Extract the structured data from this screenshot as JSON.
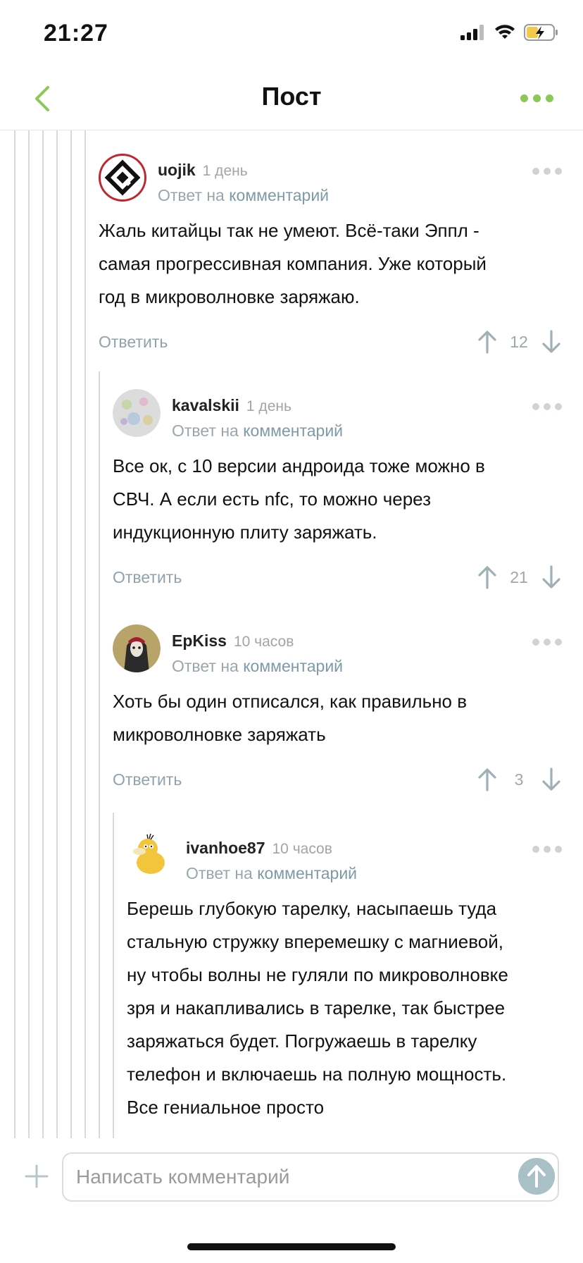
{
  "status": {
    "time": "21:27"
  },
  "nav": {
    "title": "Пост"
  },
  "colors": {
    "accent": "#8ac858",
    "link": "#7d9aa8",
    "muted": "#9aa6ab"
  },
  "comments": [
    {
      "author": "uojik",
      "time": "1 день",
      "reply_prefix": "Ответ на",
      "reply_link": "комментарий",
      "text_lines": [
        "Жаль китайцы так не умеют. Всё-таки Эппл -",
        "самая прогрессивная компания. Уже который",
        "год в микроволновке заряжаю."
      ],
      "reply_label": "Ответить",
      "votes": "12",
      "avatar_icon": "g-logo-avatar"
    },
    {
      "author": "kavalskii",
      "time": "1 день",
      "reply_prefix": "Ответ на",
      "reply_link": "комментарий",
      "text_lines": [
        "Все ок, с 10 версии андроида тоже можно в",
        "СВЧ. А если есть nfc, то можно через",
        "индукционную плиту заряжать."
      ],
      "reply_label": "Ответить",
      "votes": "21",
      "avatar_icon": "photo-avatar"
    },
    {
      "author": "EpKiss",
      "time": "10 часов",
      "reply_prefix": "Ответ на",
      "reply_link": "комментарий",
      "text_lines": [
        "Хоть бы один отписался,  как правильно в",
        "микроволновке заряжать"
      ],
      "reply_label": "Ответить",
      "votes": "3",
      "avatar_icon": "hooded-figure-avatar"
    },
    {
      "author": "ivanhoe87",
      "time": "10 часов",
      "reply_prefix": "Ответ на",
      "reply_link": "комментарий",
      "text_lines": [
        "Берешь глубокую тарелку, насыпаешь туда",
        "стальную стружку вперемешку с магниевой,",
        "ну чтобы волны не гуляли по микроволновке",
        "зря и накапливались в тарелке, так быстрее",
        "заряжаться будет. Погружаешь в тарелку",
        "телефон и включаешь на полную мощность.",
        "Все гениальное просто"
      ],
      "avatar_icon": "psyduck-avatar"
    }
  ],
  "composer": {
    "placeholder": "Написать комментарий"
  }
}
